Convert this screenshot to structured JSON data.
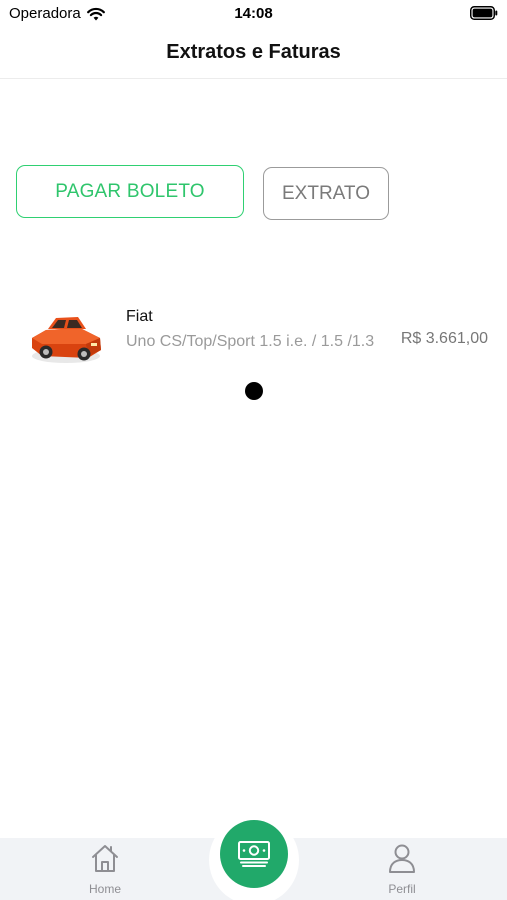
{
  "status_bar": {
    "carrier": "Operadora",
    "time": "14:08",
    "wifi_icon": "wifi-icon",
    "battery_icon": "battery-icon"
  },
  "header": {
    "title": "Extratos e Faturas"
  },
  "actions": {
    "pay_label": "PAGAR BOLETO",
    "statement_label": "EXTRATO"
  },
  "vehicle": {
    "icon": "car-icon",
    "brand": "Fiat",
    "model": "Uno CS/Top/Sport 1.5 i.e. / 1.5 /1.3",
    "price": "R$ 3.661,00"
  },
  "tab_bar": {
    "home_label": "Home",
    "home_icon": "home-icon",
    "center_icon": "money-icon",
    "profile_label": "Perfil",
    "profile_icon": "person-icon"
  },
  "colors": {
    "accent_green": "#2fd072",
    "center_button": "#21a96a",
    "car_body": "#e8501a"
  }
}
